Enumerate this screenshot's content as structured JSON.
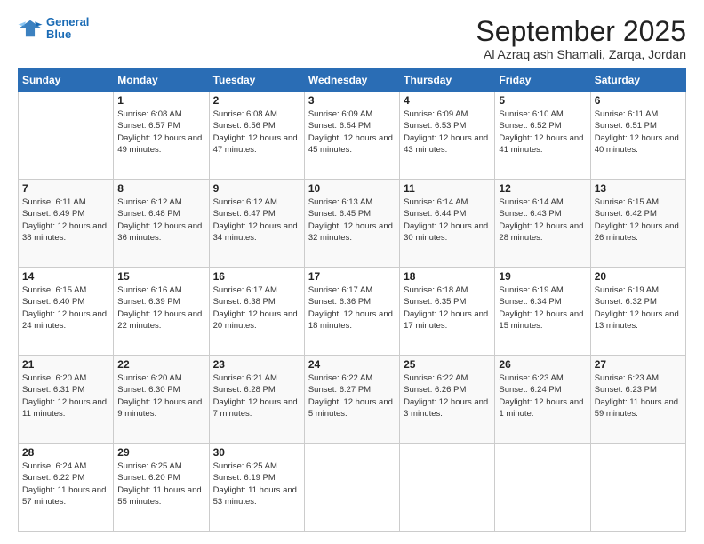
{
  "logo": {
    "line1": "General",
    "line2": "Blue"
  },
  "title": "September 2025",
  "location": "Al Azraq ash Shamali, Zarqa, Jordan",
  "days_of_week": [
    "Sunday",
    "Monday",
    "Tuesday",
    "Wednesday",
    "Thursday",
    "Friday",
    "Saturday"
  ],
  "weeks": [
    [
      {
        "day": "",
        "sunrise": "",
        "sunset": "",
        "daylight": ""
      },
      {
        "day": "1",
        "sunrise": "Sunrise: 6:08 AM",
        "sunset": "Sunset: 6:57 PM",
        "daylight": "Daylight: 12 hours and 49 minutes."
      },
      {
        "day": "2",
        "sunrise": "Sunrise: 6:08 AM",
        "sunset": "Sunset: 6:56 PM",
        "daylight": "Daylight: 12 hours and 47 minutes."
      },
      {
        "day": "3",
        "sunrise": "Sunrise: 6:09 AM",
        "sunset": "Sunset: 6:54 PM",
        "daylight": "Daylight: 12 hours and 45 minutes."
      },
      {
        "day": "4",
        "sunrise": "Sunrise: 6:09 AM",
        "sunset": "Sunset: 6:53 PM",
        "daylight": "Daylight: 12 hours and 43 minutes."
      },
      {
        "day": "5",
        "sunrise": "Sunrise: 6:10 AM",
        "sunset": "Sunset: 6:52 PM",
        "daylight": "Daylight: 12 hours and 41 minutes."
      },
      {
        "day": "6",
        "sunrise": "Sunrise: 6:11 AM",
        "sunset": "Sunset: 6:51 PM",
        "daylight": "Daylight: 12 hours and 40 minutes."
      }
    ],
    [
      {
        "day": "7",
        "sunrise": "Sunrise: 6:11 AM",
        "sunset": "Sunset: 6:49 PM",
        "daylight": "Daylight: 12 hours and 38 minutes."
      },
      {
        "day": "8",
        "sunrise": "Sunrise: 6:12 AM",
        "sunset": "Sunset: 6:48 PM",
        "daylight": "Daylight: 12 hours and 36 minutes."
      },
      {
        "day": "9",
        "sunrise": "Sunrise: 6:12 AM",
        "sunset": "Sunset: 6:47 PM",
        "daylight": "Daylight: 12 hours and 34 minutes."
      },
      {
        "day": "10",
        "sunrise": "Sunrise: 6:13 AM",
        "sunset": "Sunset: 6:45 PM",
        "daylight": "Daylight: 12 hours and 32 minutes."
      },
      {
        "day": "11",
        "sunrise": "Sunrise: 6:14 AM",
        "sunset": "Sunset: 6:44 PM",
        "daylight": "Daylight: 12 hours and 30 minutes."
      },
      {
        "day": "12",
        "sunrise": "Sunrise: 6:14 AM",
        "sunset": "Sunset: 6:43 PM",
        "daylight": "Daylight: 12 hours and 28 minutes."
      },
      {
        "day": "13",
        "sunrise": "Sunrise: 6:15 AM",
        "sunset": "Sunset: 6:42 PM",
        "daylight": "Daylight: 12 hours and 26 minutes."
      }
    ],
    [
      {
        "day": "14",
        "sunrise": "Sunrise: 6:15 AM",
        "sunset": "Sunset: 6:40 PM",
        "daylight": "Daylight: 12 hours and 24 minutes."
      },
      {
        "day": "15",
        "sunrise": "Sunrise: 6:16 AM",
        "sunset": "Sunset: 6:39 PM",
        "daylight": "Daylight: 12 hours and 22 minutes."
      },
      {
        "day": "16",
        "sunrise": "Sunrise: 6:17 AM",
        "sunset": "Sunset: 6:38 PM",
        "daylight": "Daylight: 12 hours and 20 minutes."
      },
      {
        "day": "17",
        "sunrise": "Sunrise: 6:17 AM",
        "sunset": "Sunset: 6:36 PM",
        "daylight": "Daylight: 12 hours and 18 minutes."
      },
      {
        "day": "18",
        "sunrise": "Sunrise: 6:18 AM",
        "sunset": "Sunset: 6:35 PM",
        "daylight": "Daylight: 12 hours and 17 minutes."
      },
      {
        "day": "19",
        "sunrise": "Sunrise: 6:19 AM",
        "sunset": "Sunset: 6:34 PM",
        "daylight": "Daylight: 12 hours and 15 minutes."
      },
      {
        "day": "20",
        "sunrise": "Sunrise: 6:19 AM",
        "sunset": "Sunset: 6:32 PM",
        "daylight": "Daylight: 12 hours and 13 minutes."
      }
    ],
    [
      {
        "day": "21",
        "sunrise": "Sunrise: 6:20 AM",
        "sunset": "Sunset: 6:31 PM",
        "daylight": "Daylight: 12 hours and 11 minutes."
      },
      {
        "day": "22",
        "sunrise": "Sunrise: 6:20 AM",
        "sunset": "Sunset: 6:30 PM",
        "daylight": "Daylight: 12 hours and 9 minutes."
      },
      {
        "day": "23",
        "sunrise": "Sunrise: 6:21 AM",
        "sunset": "Sunset: 6:28 PM",
        "daylight": "Daylight: 12 hours and 7 minutes."
      },
      {
        "day": "24",
        "sunrise": "Sunrise: 6:22 AM",
        "sunset": "Sunset: 6:27 PM",
        "daylight": "Daylight: 12 hours and 5 minutes."
      },
      {
        "day": "25",
        "sunrise": "Sunrise: 6:22 AM",
        "sunset": "Sunset: 6:26 PM",
        "daylight": "Daylight: 12 hours and 3 minutes."
      },
      {
        "day": "26",
        "sunrise": "Sunrise: 6:23 AM",
        "sunset": "Sunset: 6:24 PM",
        "daylight": "Daylight: 12 hours and 1 minute."
      },
      {
        "day": "27",
        "sunrise": "Sunrise: 6:23 AM",
        "sunset": "Sunset: 6:23 PM",
        "daylight": "Daylight: 11 hours and 59 minutes."
      }
    ],
    [
      {
        "day": "28",
        "sunrise": "Sunrise: 6:24 AM",
        "sunset": "Sunset: 6:22 PM",
        "daylight": "Daylight: 11 hours and 57 minutes."
      },
      {
        "day": "29",
        "sunrise": "Sunrise: 6:25 AM",
        "sunset": "Sunset: 6:20 PM",
        "daylight": "Daylight: 11 hours and 55 minutes."
      },
      {
        "day": "30",
        "sunrise": "Sunrise: 6:25 AM",
        "sunset": "Sunset: 6:19 PM",
        "daylight": "Daylight: 11 hours and 53 minutes."
      },
      {
        "day": "",
        "sunrise": "",
        "sunset": "",
        "daylight": ""
      },
      {
        "day": "",
        "sunrise": "",
        "sunset": "",
        "daylight": ""
      },
      {
        "day": "",
        "sunrise": "",
        "sunset": "",
        "daylight": ""
      },
      {
        "day": "",
        "sunrise": "",
        "sunset": "",
        "daylight": ""
      }
    ]
  ]
}
